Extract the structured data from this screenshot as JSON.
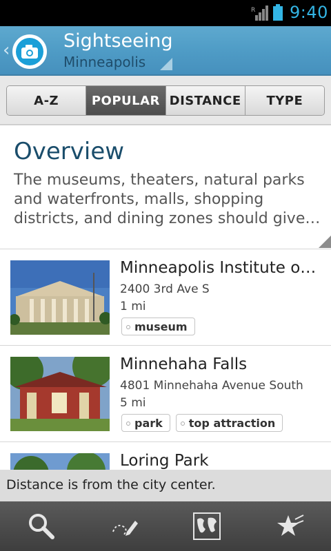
{
  "status_bar": {
    "time": "9:40",
    "icons": [
      "signal-icon",
      "battery-icon"
    ]
  },
  "action_bar": {
    "title": "Sightseeing",
    "subtitle": "Minneapolis",
    "icons": [
      "back-chevron-icon",
      "camera-logo-icon",
      "dropdown-triangle-icon"
    ],
    "accent": "#4f9cc6"
  },
  "tabs": [
    {
      "label": "A-Z",
      "active": false
    },
    {
      "label": "POPULAR",
      "active": true
    },
    {
      "label": "DISTANCE",
      "active": false
    },
    {
      "label": "TYPE",
      "active": false
    }
  ],
  "overview": {
    "title": "Overview",
    "text": "The museums, theaters, natural parks and waterfronts, malls, shopping districts, and dining zones should give…"
  },
  "places": [
    {
      "title": "Minneapolis Institute of…",
      "address": "2400 3rd Ave S",
      "distance": "1 mi",
      "tags": [
        "museum"
      ]
    },
    {
      "title": "Minnehaha Falls",
      "address": "4801 Minnehaha Avenue South",
      "distance": "5 mi",
      "tags": [
        "park",
        "top attraction"
      ]
    },
    {
      "title": "Loring Park",
      "address": "",
      "distance": "",
      "tags": []
    }
  ],
  "info_bar": {
    "text": "Distance is from the city center."
  },
  "bottom_nav": [
    {
      "icon": "search-icon"
    },
    {
      "icon": "edit-route-icon"
    },
    {
      "icon": "map-icon"
    },
    {
      "icon": "favorites-star-icon"
    }
  ],
  "colors": {
    "status_time": "#33b5e5",
    "title_blue": "#1a4d6b",
    "active_tab": "#555555"
  }
}
